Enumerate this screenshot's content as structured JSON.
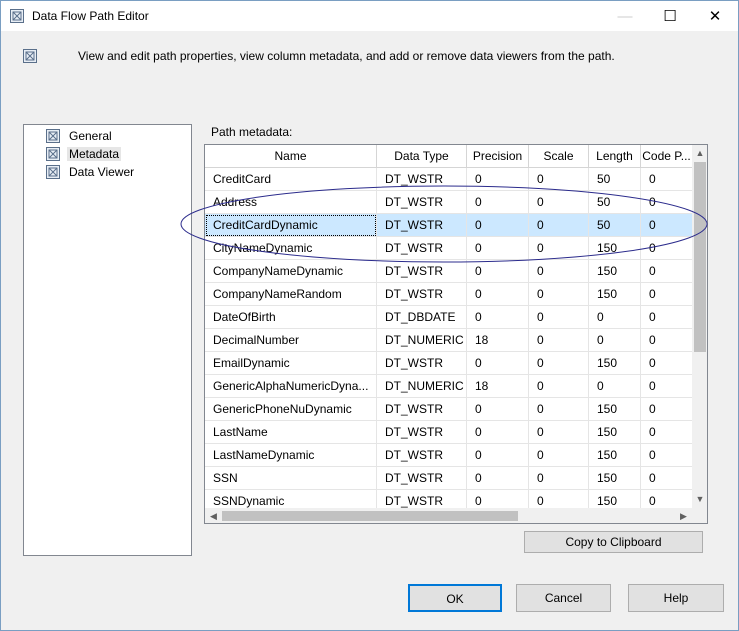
{
  "window": {
    "title": "Data Flow Path Editor",
    "controls": {
      "minimize": "—",
      "maximize": "☐",
      "close": "✕"
    }
  },
  "description": "View and edit path properties, view column metadata, and add or remove data viewers from the path.",
  "tree": {
    "items": [
      {
        "label": "General",
        "icon": "property-page-icon",
        "selected": false
      },
      {
        "label": "Metadata",
        "icon": "property-page-icon",
        "selected": true
      },
      {
        "label": "Data Viewer",
        "icon": "property-page-icon",
        "selected": false
      }
    ]
  },
  "metadata": {
    "label": "Path metadata:",
    "columns": [
      "Name",
      "Data Type",
      "Precision",
      "Scale",
      "Length",
      "Code P..."
    ],
    "rows": [
      [
        "CreditCard",
        "DT_WSTR",
        "0",
        "0",
        "50",
        "0"
      ],
      [
        "Address",
        "DT_WSTR",
        "0",
        "0",
        "50",
        "0"
      ],
      [
        "CreditCardDynamic",
        "DT_WSTR",
        "0",
        "0",
        "50",
        "0"
      ],
      [
        "CityNameDynamic",
        "DT_WSTR",
        "0",
        "0",
        "150",
        "0"
      ],
      [
        "CompanyNameDynamic",
        "DT_WSTR",
        "0",
        "0",
        "150",
        "0"
      ],
      [
        "CompanyNameRandom",
        "DT_WSTR",
        "0",
        "0",
        "150",
        "0"
      ],
      [
        "DateOfBirth",
        "DT_DBDATE",
        "0",
        "0",
        "0",
        "0"
      ],
      [
        "DecimalNumber",
        "DT_NUMERIC",
        "18",
        "0",
        "0",
        "0"
      ],
      [
        "EmailDynamic",
        "DT_WSTR",
        "0",
        "0",
        "150",
        "0"
      ],
      [
        "GenericAlphaNumericDyna...",
        "DT_NUMERIC",
        "18",
        "0",
        "0",
        "0"
      ],
      [
        "GenericPhoneNuDynamic",
        "DT_WSTR",
        "0",
        "0",
        "150",
        "0"
      ],
      [
        "LastName",
        "DT_WSTR",
        "0",
        "0",
        "150",
        "0"
      ],
      [
        "LastNameDynamic",
        "DT_WSTR",
        "0",
        "0",
        "150",
        "0"
      ],
      [
        "SSN",
        "DT_WSTR",
        "0",
        "0",
        "150",
        "0"
      ],
      [
        "SSNDynamic",
        "DT_WSTR",
        "0",
        "0",
        "150",
        "0"
      ]
    ],
    "selected_row": 2,
    "highlight_color": "#cce8ff",
    "annotation_color": "#2b2b8c"
  },
  "buttons": {
    "copy": "Copy to Clipboard",
    "ok": "OK",
    "cancel": "Cancel",
    "help": "Help"
  }
}
